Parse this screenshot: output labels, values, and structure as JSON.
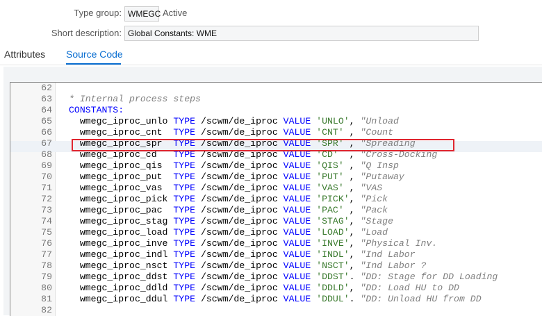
{
  "header": {
    "type_group_label": "Type group:",
    "type_group_value": "WMEGC",
    "status": "Active",
    "short_desc_label": "Short description:",
    "short_desc_value": "Global Constants: WME"
  },
  "tabs": [
    {
      "label": "Attributes",
      "active": false
    },
    {
      "label": "Source Code",
      "active": true
    }
  ],
  "editor": {
    "highlight_line": 67,
    "lines": [
      {
        "num": "62"
      },
      {
        "num": "63",
        "comment": "* Internal process steps"
      },
      {
        "num": "64",
        "keyword": "CONSTANTS:"
      },
      {
        "num": "65",
        "name": "wmegc_iproc_unlo",
        "kw1": "TYPE",
        "type": "/scwm/de_iproc",
        "kw2": "VALUE",
        "value": "'UNLO'",
        "sep": ",",
        "comment": "\"Unload"
      },
      {
        "num": "66",
        "name": "wmegc_iproc_cnt ",
        "kw1": "TYPE",
        "type": "/scwm/de_iproc",
        "kw2": "VALUE",
        "value": "'CNT' ",
        "sep": ",",
        "comment": "\"Count"
      },
      {
        "num": "67",
        "name": "wmegc_iproc_spr ",
        "kw1": "TYPE",
        "type": "/scwm/de_iproc",
        "kw2": "VALUE",
        "value": "'SPR' ",
        "sep": ",",
        "comment": "\"Spreading"
      },
      {
        "num": "68",
        "name": "wmegc_iproc_cd  ",
        "kw1": "TYPE",
        "type": "/scwm/de_iproc",
        "kw2": "VALUE",
        "value": "'CD'  ",
        "sep": ",",
        "comment": "\"Cross-Docking"
      },
      {
        "num": "69",
        "name": "wmegc_iproc_qis ",
        "kw1": "TYPE",
        "type": "/scwm/de_iproc",
        "kw2": "VALUE",
        "value": "'QIS' ",
        "sep": ",",
        "comment": "\"Q Insp"
      },
      {
        "num": "70",
        "name": "wmegc_iproc_put ",
        "kw1": "TYPE",
        "type": "/scwm/de_iproc",
        "kw2": "VALUE",
        "value": "'PUT' ",
        "sep": ",",
        "comment": "\"Putaway"
      },
      {
        "num": "71",
        "name": "wmegc_iproc_vas ",
        "kw1": "TYPE",
        "type": "/scwm/de_iproc",
        "kw2": "VALUE",
        "value": "'VAS' ",
        "sep": ",",
        "comment": "\"VAS"
      },
      {
        "num": "72",
        "name": "wmegc_iproc_pick",
        "kw1": "TYPE",
        "type": "/scwm/de_iproc",
        "kw2": "VALUE",
        "value": "'PICK'",
        "sep": ",",
        "comment": "\"Pick"
      },
      {
        "num": "73",
        "name": "wmegc_iproc_pac ",
        "kw1": "TYPE",
        "type": "/scwm/de_iproc",
        "kw2": "VALUE",
        "value": "'PAC' ",
        "sep": ",",
        "comment": "\"Pack"
      },
      {
        "num": "74",
        "name": "wmegc_iproc_stag",
        "kw1": "TYPE",
        "type": "/scwm/de_iproc",
        "kw2": "VALUE",
        "value": "'STAG'",
        "sep": ",",
        "comment": "\"Stage"
      },
      {
        "num": "75",
        "name": "wmegc_iproc_load",
        "kw1": "TYPE",
        "type": "/scwm/de_iproc",
        "kw2": "VALUE",
        "value": "'LOAD'",
        "sep": ",",
        "comment": "\"Load"
      },
      {
        "num": "76",
        "name": "wmegc_iproc_inve",
        "kw1": "TYPE",
        "type": "/scwm/de_iproc",
        "kw2": "VALUE",
        "value": "'INVE'",
        "sep": ",",
        "comment": "\"Physical Inv."
      },
      {
        "num": "77",
        "name": "wmegc_iproc_indl",
        "kw1": "TYPE",
        "type": "/scwm/de_iproc",
        "kw2": "VALUE",
        "value": "'INDL'",
        "sep": ",",
        "comment": "\"Ind Labor"
      },
      {
        "num": "78",
        "name": "wmegc_iproc_nsct",
        "kw1": "TYPE",
        "type": "/scwm/de_iproc",
        "kw2": "VALUE",
        "value": "'NSCT'",
        "sep": ",",
        "comment": "\"Ind Labor ?"
      },
      {
        "num": "79",
        "name": "wmegc_iproc_ddst",
        "kw1": "TYPE",
        "type": "/scwm/de_iproc",
        "kw2": "VALUE",
        "value": "'DDST'",
        "sep": ".",
        "comment": "\"DD: Stage for DD Loading"
      },
      {
        "num": "80",
        "name": "wmegc_iproc_ddld",
        "kw1": "TYPE",
        "type": "/scwm/de_iproc",
        "kw2": "VALUE",
        "value": "'DDLD'",
        "sep": ",",
        "comment": "\"DD: Load HU to DD"
      },
      {
        "num": "81",
        "name": "wmegc_iproc_ddul",
        "kw1": "TYPE",
        "type": "/scwm/de_iproc",
        "kw2": "VALUE",
        "value": "'DDUL'",
        "sep": ".",
        "comment": "\"DD: Unload HU from DD"
      },
      {
        "num": "82"
      }
    ]
  }
}
